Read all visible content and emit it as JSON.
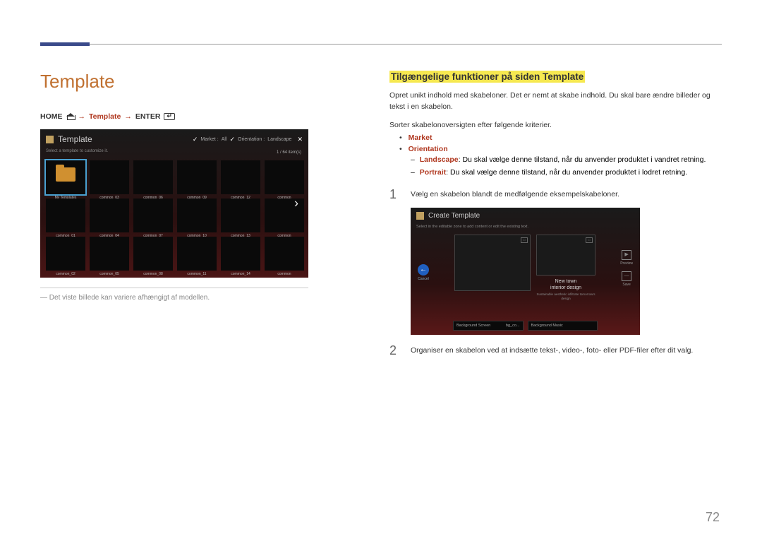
{
  "page": {
    "number": "72",
    "heading": "Template",
    "breadcrumb": {
      "home": "HOME",
      "sep": "→",
      "template": "Template",
      "enter": "ENTER"
    },
    "caption_prefix": "―",
    "caption": "Det viste billede kan variere afhængigt af modellen."
  },
  "ui_template": {
    "title": "Template",
    "subtitle": "Select a template to customize it.",
    "market_label": "Market :",
    "market_value": "All",
    "orientation_label": "Orientation :",
    "orientation_value": "Landscape",
    "count": "1 / 64 item(s)",
    "my_templates": "My Templates",
    "cells": [
      "common_03",
      "common_06",
      "common_09",
      "common_12",
      "common",
      "common_01",
      "common_04",
      "common_07",
      "common_10",
      "common_13",
      "common",
      "common_02",
      "common_05",
      "common_08",
      "common_11",
      "common_14",
      "common"
    ]
  },
  "right": {
    "heading": "Tilgængelige funktioner på siden Template",
    "intro": "Opret unikt indhold med skabeloner. Det er nemt at skabe indhold. Du skal bare ændre billeder og tekst i en skabelon.",
    "sort_intro": "Sorter skabelonoversigten efter følgende kriterier.",
    "market": "Market",
    "orientation": "Orientation",
    "landscape_label": "Landscape",
    "landscape_text": ": Du skal vælge denne tilstand, når du anvender produktet i vandret retning.",
    "portrait_label": "Portrait",
    "portrait_text": ": Du skal vælge denne tilstand, når du anvender produktet i lodret retning.",
    "step1_num": "1",
    "step1": "Vælg en skabelon blandt de medfølgende eksempelskabeloner.",
    "step2_num": "2",
    "step2": "Organiser en skabelon ved at indsætte tekst-, video-, foto- eller PDF-filer efter dit valg."
  },
  "ui_create": {
    "title": "Create Template",
    "subtitle": "Select in the editable zone to add content or edit the existing text.",
    "cancel": "Cancel",
    "preview": "Preview",
    "save": "Save",
    "text1": "New town",
    "text2": "interior design",
    "text3": "Sustainable aesthetic infiltrate tomorrow's design",
    "bg_screen_label": "Background Screen",
    "bg_screen_value": "bg_co...",
    "bg_music_label": "Background Music"
  }
}
